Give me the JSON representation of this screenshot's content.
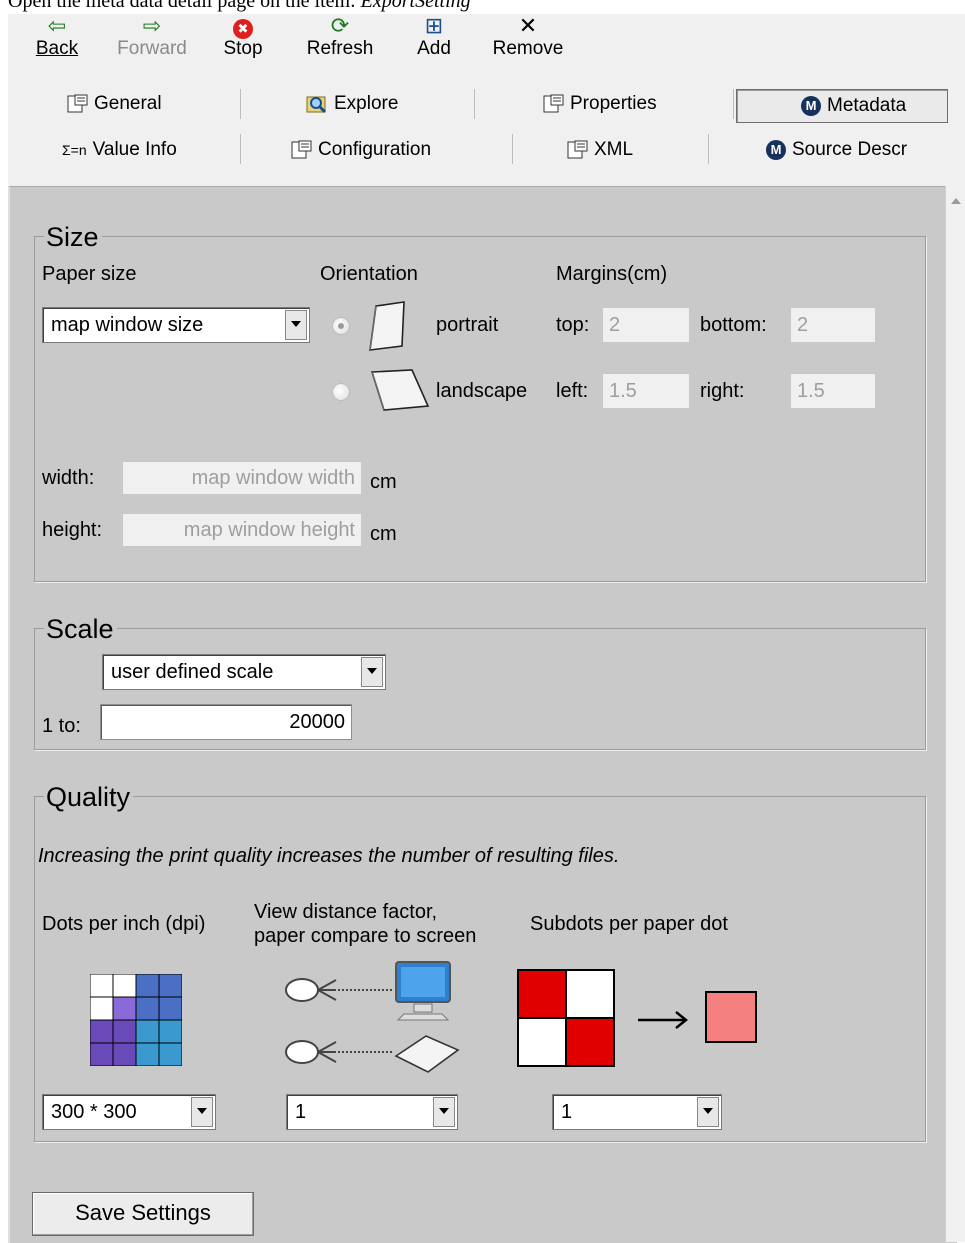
{
  "caption": {
    "prefix": "Open the meta data detail page on the item: ",
    "item": "ExportSetting"
  },
  "toolbar": [
    {
      "name": "back",
      "label": "Back",
      "icon": "⇦"
    },
    {
      "name": "forward",
      "label": "Forward",
      "icon": "⇨"
    },
    {
      "name": "stop",
      "label": "Stop",
      "icon": "✖"
    },
    {
      "name": "refresh",
      "label": "Refresh",
      "icon": "⟳"
    },
    {
      "name": "add",
      "label": "Add",
      "icon": "⊞"
    },
    {
      "name": "remove",
      "label": "Remove",
      "icon": "✕"
    }
  ],
  "tabs": {
    "general": "General",
    "explore": "Explore",
    "properties": "Properties",
    "metadata": "Metadata",
    "value_info": "Value Info",
    "value_info_icon": "Σ=n",
    "configuration": "Configuration",
    "xml": "XML",
    "source_descr": "Source Descr",
    "m_badge": "M"
  },
  "size": {
    "legend": "Size",
    "paper_size_label": "Paper size",
    "paper_size_value": "map window size",
    "orientation_label": "Orientation",
    "portrait": "portrait",
    "landscape": "landscape",
    "margins_label": "Margins(cm)",
    "top_label": "top:",
    "top_value": "2",
    "bottom_label": "bottom:",
    "bottom_value": "2",
    "left_label": "left:",
    "left_value": "1.5",
    "right_label": "right:",
    "right_value": "1.5",
    "width_label": "width:",
    "width_value": "map window width",
    "height_label": "height:",
    "height_value": "map window height",
    "unit_cm": "cm"
  },
  "scale": {
    "legend": "Scale",
    "mode_value": "user defined scale",
    "one_to_label": "1 to:",
    "one_to_value": "20000"
  },
  "quality": {
    "legend": "Quality",
    "note": "Increasing the print quality increases the number of resulting files.",
    "dpi_label": "Dots per inch (dpi)",
    "view_label_1": "View distance factor,",
    "view_label_2": "paper compare to screen",
    "subdots_label": "Subdots per paper dot",
    "dpi_value": "300 * 300",
    "view_value": "1",
    "subdots_value": "1"
  },
  "save_button": "Save Settings",
  "colors": {
    "panel": "#c9c9c9",
    "subdot_red": "#e00000",
    "subdot_result": "#f58080",
    "monitor_blue": "#2f7fd0"
  }
}
